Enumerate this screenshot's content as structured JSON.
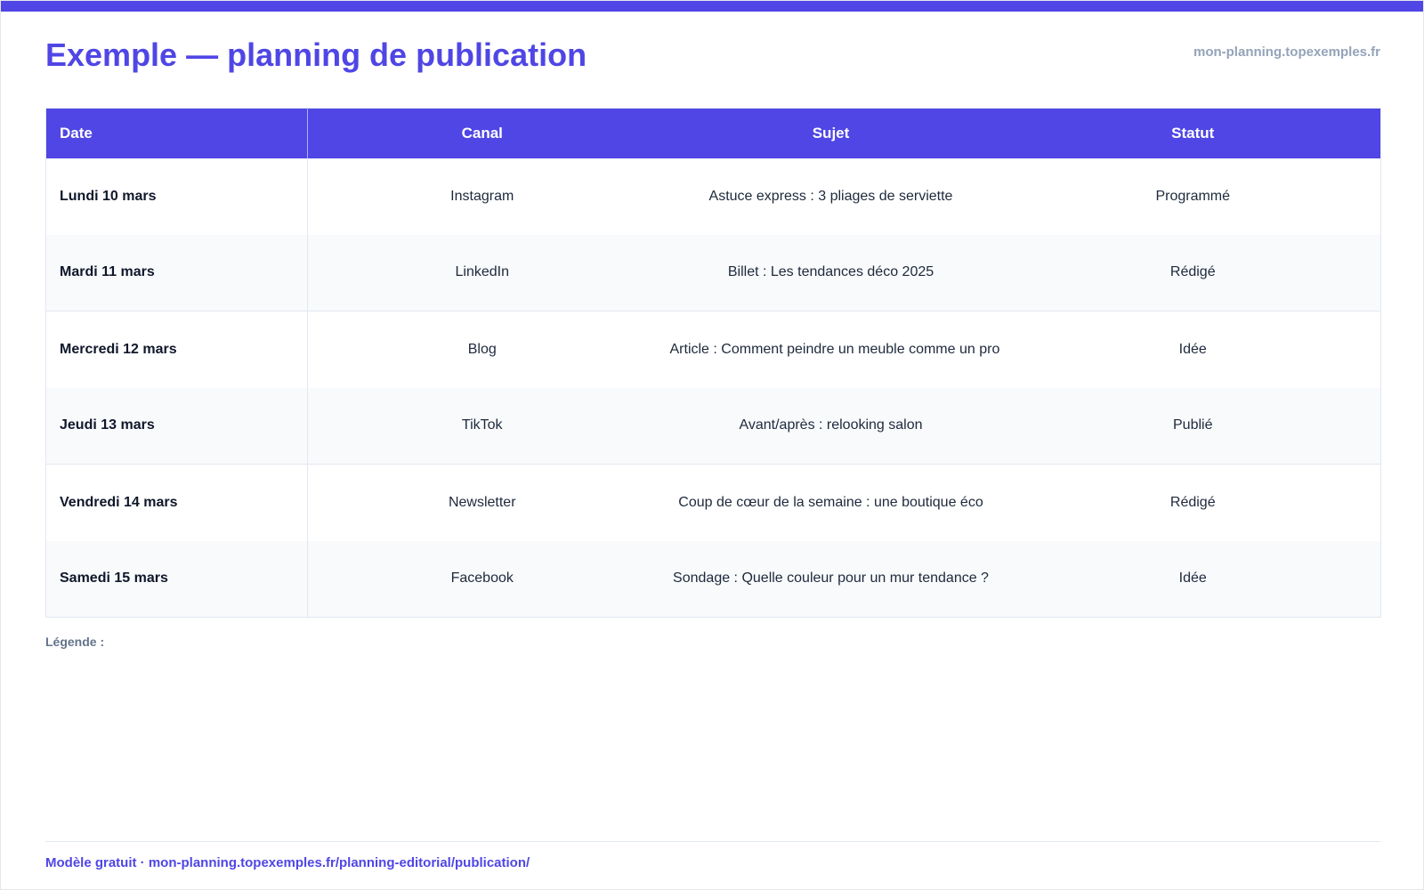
{
  "header": {
    "title": "Exemple — planning de publication",
    "site": "mon-planning.topexemples.fr"
  },
  "table": {
    "columns": [
      "Date",
      "Canal",
      "Sujet",
      "Statut"
    ],
    "rows": [
      {
        "date": "Lundi 10 mars",
        "canal": "Instagram",
        "sujet": "Astuce express : 3 pliages de serviette",
        "statut": "Programmé"
      },
      {
        "date": "Mardi 11 mars",
        "canal": "LinkedIn",
        "sujet": "Billet : Les tendances déco 2025",
        "statut": "Rédigé"
      },
      {
        "date": "Mercredi 12 mars",
        "canal": "Blog",
        "sujet": "Article : Comment peindre un meuble comme un pro",
        "statut": "Idée"
      },
      {
        "date": "Jeudi 13 mars",
        "canal": "TikTok",
        "sujet": "Avant/après : relooking salon",
        "statut": "Publié"
      },
      {
        "date": "Vendredi 14 mars",
        "canal": "Newsletter",
        "sujet": "Coup de cœur de la semaine : une boutique éco",
        "statut": "Rédigé"
      },
      {
        "date": "Samedi 15 mars",
        "canal": "Facebook",
        "sujet": "Sondage : Quelle couleur pour un mur tendance ?",
        "statut": "Idée"
      }
    ]
  },
  "legend": {
    "label": "Légende :"
  },
  "footer": {
    "text": "Modèle gratuit · mon-planning.topexemples.fr/planning-editorial/publication/"
  },
  "colors": {
    "accent": "#4f46e5",
    "muted": "#94a3b8",
    "row_alt": "#f8fafc"
  }
}
